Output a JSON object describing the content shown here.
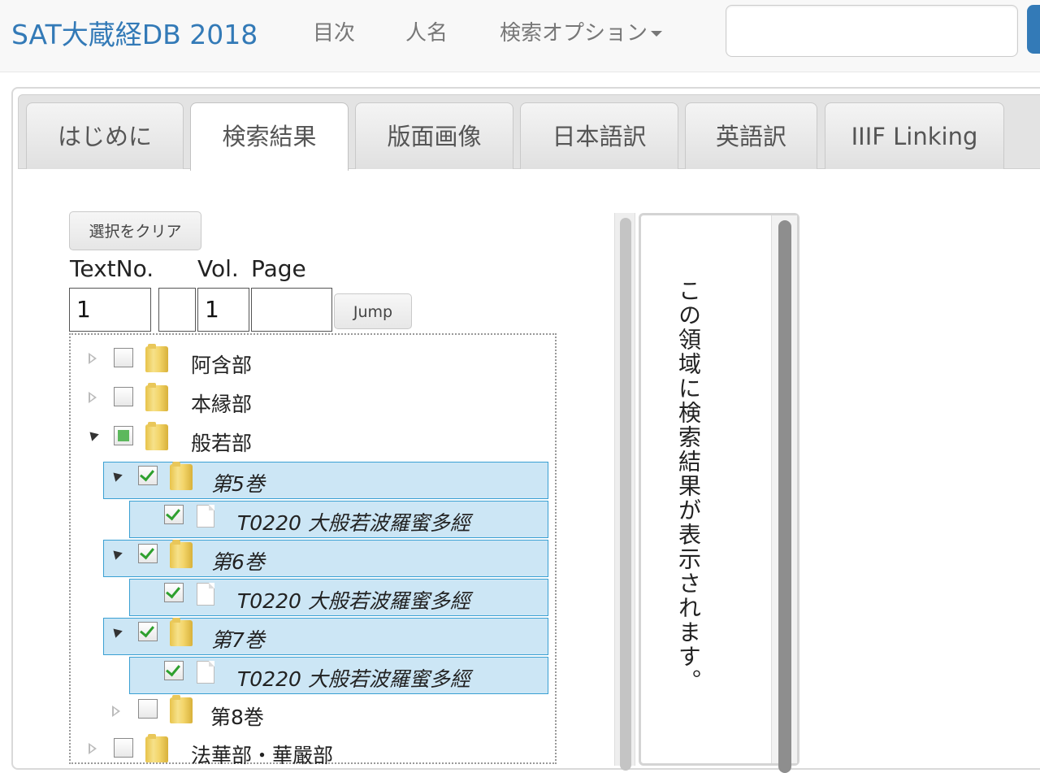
{
  "navbar": {
    "brand": "SAT大蔵経DB 2018",
    "links": [
      "目次",
      "人名",
      "検索オプション"
    ],
    "search": {
      "placeholder": "",
      "value": ""
    }
  },
  "tabs": [
    {
      "label": "はじめに",
      "active": false
    },
    {
      "label": "検索結果",
      "active": true
    },
    {
      "label": "版面画像",
      "active": false
    },
    {
      "label": "日本語訳",
      "active": false
    },
    {
      "label": "英語訳",
      "active": false
    },
    {
      "label": "IIIF Linking",
      "active": false
    }
  ],
  "controls": {
    "clear_label": "選択をクリア",
    "textno_label": "TextNo.",
    "vol_label": "Vol.",
    "page_label": "Page",
    "textno_value": "1",
    "mid_value": "",
    "vol_value": "1",
    "page_value": "",
    "jump_label": "Jump"
  },
  "tree": [
    {
      "label": "阿含部",
      "level": 0,
      "expanded": false,
      "check": "none",
      "type": "folder"
    },
    {
      "label": "本縁部",
      "level": 0,
      "expanded": false,
      "check": "none",
      "type": "folder"
    },
    {
      "label": "般若部",
      "level": 0,
      "expanded": true,
      "check": "partial",
      "type": "folder"
    },
    {
      "label": "第5巻",
      "level": 1,
      "expanded": true,
      "check": "checked",
      "type": "folder",
      "selected": true
    },
    {
      "label": "T0220 大般若波羅蜜多經",
      "level": 2,
      "check": "checked",
      "type": "doc",
      "selected": true
    },
    {
      "label": "第6巻",
      "level": 1,
      "expanded": true,
      "check": "checked",
      "type": "folder",
      "selected": true
    },
    {
      "label": "T0220 大般若波羅蜜多經",
      "level": 2,
      "check": "checked",
      "type": "doc",
      "selected": true
    },
    {
      "label": "第7巻",
      "level": 1,
      "expanded": true,
      "check": "checked",
      "type": "folder",
      "selected": true
    },
    {
      "label": "T0220 大般若波羅蜜多經",
      "level": 2,
      "check": "checked",
      "type": "doc",
      "selected": true
    },
    {
      "label": "第8巻",
      "level": 1,
      "expanded": false,
      "check": "none",
      "type": "folder"
    },
    {
      "label": "法華部・華嚴部",
      "level": 0,
      "expanded": false,
      "check": "none",
      "type": "folder"
    }
  ],
  "result": {
    "placeholder_text": "この領域に検索結果が表示されます。"
  },
  "colors": {
    "brand": "#337ab7",
    "selection_bg": "#cce6f5",
    "selection_border": "#3aa0d3",
    "check": "#2ea02e"
  }
}
